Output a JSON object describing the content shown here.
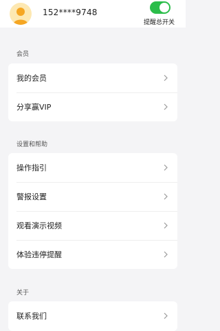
{
  "header": {
    "phone": "152****9748",
    "reminder_toggle": {
      "label": "提醒总开关",
      "on": true,
      "color": "#2bbd4a"
    },
    "avatar_icon": "user-avatar-icon"
  },
  "sections": [
    {
      "title": "会员",
      "items": [
        "我的会员",
        "分享赢VIP"
      ]
    },
    {
      "title": "设置和帮助",
      "items": [
        "操作指引",
        "警报设置",
        "观看演示视频",
        "体验违停提醒"
      ]
    },
    {
      "title": "关于",
      "items": [
        "联系我们"
      ]
    }
  ],
  "chevron_icon": "chevron-right-icon"
}
